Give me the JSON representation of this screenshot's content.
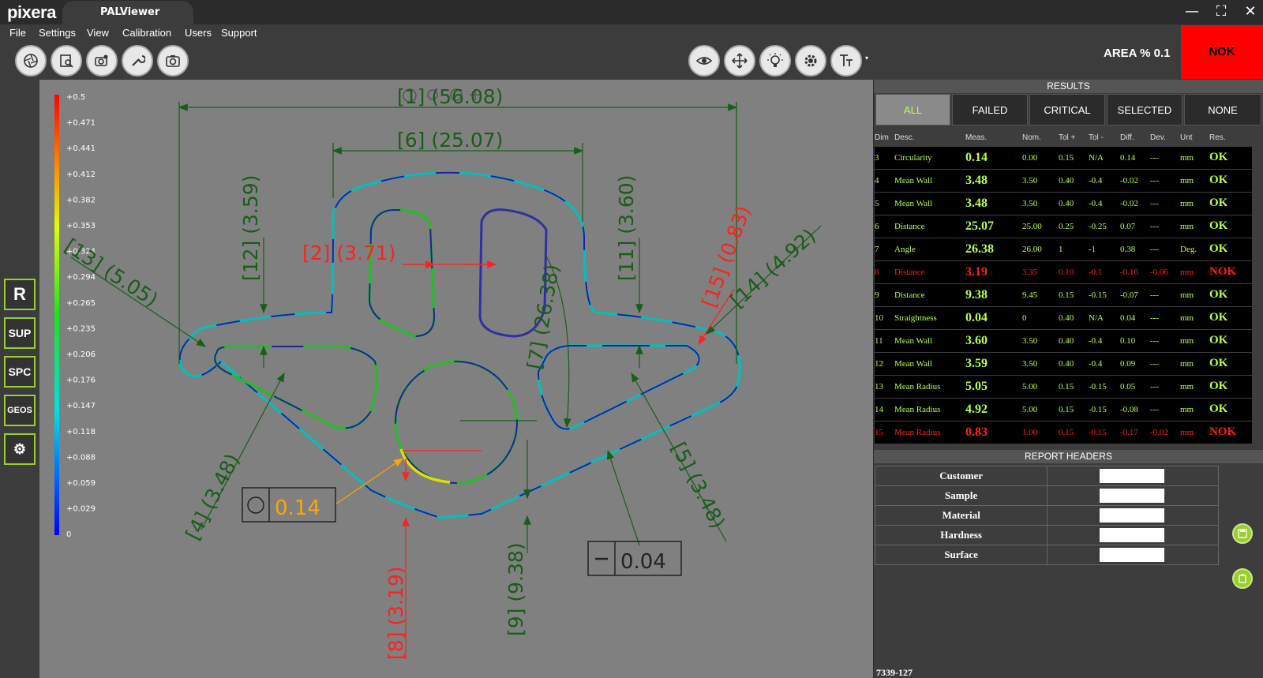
{
  "app": {
    "logo_text": "pixera",
    "tab_title": "PALViewer"
  },
  "window_controls": {
    "minimize": "—",
    "maximize": "⛶",
    "close": "✕"
  },
  "menu": {
    "items": [
      "File",
      "Settings",
      "View",
      "Calibration",
      "Users",
      "Support"
    ]
  },
  "toolbar": {
    "left_icons": [
      "aperture-icon",
      "inspect-icon",
      "camera-settings-icon",
      "wrench-icon",
      "snapshot-icon"
    ],
    "right_icons": [
      "eye-icon",
      "move-icon",
      "light-icon",
      "gear-icon",
      "text-icon"
    ]
  },
  "status": {
    "area_label": "AREA % 0.1",
    "verdict": "NOK",
    "verdict_color": "#ff0000"
  },
  "left_sidebar": {
    "buttons": [
      "R",
      "SUP",
      "SPC",
      "GEOS",
      "⚙"
    ]
  },
  "color_scale": {
    "labels": [
      "+0.5",
      "+0.471",
      "+0.441",
      "+0.412",
      "+0.382",
      "+0.353",
      "+0.324",
      "+0.294",
      "+0.265",
      "+0.235",
      "+0.206",
      "+0.176",
      "+0.147",
      "+0.118",
      "+0.088",
      "+0.059",
      "+0.029",
      "0"
    ]
  },
  "drawing": {
    "dims": {
      "d1": "[1] (56.08)",
      "d6": "[6] (25.07)",
      "d12": "[12] (3.59)",
      "d11": "[11] (3.60)",
      "d2": "[2] (3.71)",
      "d13": "[13] (5.05)",
      "d15": "[15] (0.83)",
      "d14": "[14] (4.92)",
      "d7": "[7] (26.38)",
      "d4": "[4] (3.48)",
      "d5": "[5] (3.48)",
      "d8": "[8] (3.19)",
      "d9": "[9] (9.38)"
    },
    "circularity_box": "0.14",
    "straightness_box": "0.04"
  },
  "results": {
    "header": "RESULTS",
    "filters": [
      "ALL",
      "FAILED",
      "CRITICAL",
      "SELECTED",
      "NONE"
    ],
    "active_filter": "ALL",
    "columns": [
      "Dim",
      "Desc.",
      "Meas.",
      "Nom.",
      "Tol +",
      "Tol -",
      "Diff.",
      "Dev.",
      "Unt",
      "Res."
    ],
    "rows": [
      {
        "dim": "3",
        "desc": "Circularity",
        "meas": "0.14",
        "nom": "0.00",
        "tolp": "0.15",
        "tolm": "N/A",
        "diff": "0.14",
        "dev": "---",
        "unit": "mm",
        "res": "OK"
      },
      {
        "dim": "4",
        "desc": "Mean Wall",
        "meas": "3.48",
        "nom": "3.50",
        "tolp": "0.40",
        "tolm": "-0.4",
        "diff": "-0.02",
        "dev": "---",
        "unit": "mm",
        "res": "OK"
      },
      {
        "dim": "5",
        "desc": "Mean Wall",
        "meas": "3.48",
        "nom": "3.50",
        "tolp": "0.40",
        "tolm": "-0.4",
        "diff": "-0.02",
        "dev": "---",
        "unit": "mm",
        "res": "OK"
      },
      {
        "dim": "6",
        "desc": "Distance",
        "meas": "25.07",
        "nom": "25.00",
        "tolp": "0.25",
        "tolm": "-0.25",
        "diff": "0.07",
        "dev": "---",
        "unit": "mm",
        "res": "OK"
      },
      {
        "dim": "7",
        "desc": "Angle",
        "meas": "26.38",
        "nom": "26.00",
        "tolp": "1",
        "tolm": "-1",
        "diff": "0.38",
        "dev": "---",
        "unit": "Deg.",
        "res": "OK"
      },
      {
        "dim": "8",
        "desc": "Distance",
        "meas": "3.19",
        "nom": "3.35",
        "tolp": "0.10",
        "tolm": "-0.1",
        "diff": "-0.16",
        "dev": "-0.06",
        "unit": "mm",
        "res": "NOK"
      },
      {
        "dim": "9",
        "desc": "Distance",
        "meas": "9.38",
        "nom": "9.45",
        "tolp": "0.15",
        "tolm": "-0.15",
        "diff": "-0.07",
        "dev": "---",
        "unit": "mm",
        "res": "OK"
      },
      {
        "dim": "10",
        "desc": "Straightness",
        "meas": "0.04",
        "nom": "0",
        "tolp": "0.40",
        "tolm": "N/A",
        "diff": "0.04",
        "dev": "---",
        "unit": "mm",
        "res": "OK"
      },
      {
        "dim": "11",
        "desc": "Mean Wall",
        "meas": "3.60",
        "nom": "3.50",
        "tolp": "0.40",
        "tolm": "-0.4",
        "diff": "0.10",
        "dev": "---",
        "unit": "mm",
        "res": "OK"
      },
      {
        "dim": "12",
        "desc": "Mean Wall",
        "meas": "3.59",
        "nom": "3.50",
        "tolp": "0.40",
        "tolm": "-0.4",
        "diff": "0.09",
        "dev": "---",
        "unit": "mm",
        "res": "OK"
      },
      {
        "dim": "13",
        "desc": "Mean Radius",
        "meas": "5.05",
        "nom": "5.00",
        "tolp": "0.15",
        "tolm": "-0.15",
        "diff": "0.05",
        "dev": "---",
        "unit": "mm",
        "res": "OK"
      },
      {
        "dim": "14",
        "desc": "Mean Radius",
        "meas": "4.92",
        "nom": "5.00",
        "tolp": "0.15",
        "tolm": "-0.15",
        "diff": "-0.08",
        "dev": "---",
        "unit": "mm",
        "res": "OK"
      },
      {
        "dim": "15",
        "desc": "Mean Radius",
        "meas": "0.83",
        "nom": "1.00",
        "tolp": "0.15",
        "tolm": "-0.15",
        "diff": "-0.17",
        "dev": "-0.02",
        "unit": "mm",
        "res": "NOK"
      }
    ]
  },
  "report": {
    "header": "REPORT HEADERS",
    "fields": [
      "Customer",
      "Sample",
      "Material",
      "Hardness",
      "Surface"
    ]
  },
  "part_id": "7339-127",
  "colors": {
    "accent": "#9acd32",
    "ok": "#b8ff4c",
    "nok": "#ff2020",
    "dim_green": "#1a5c1a",
    "dim_red": "#ff2020",
    "callout": "#ffa500"
  }
}
